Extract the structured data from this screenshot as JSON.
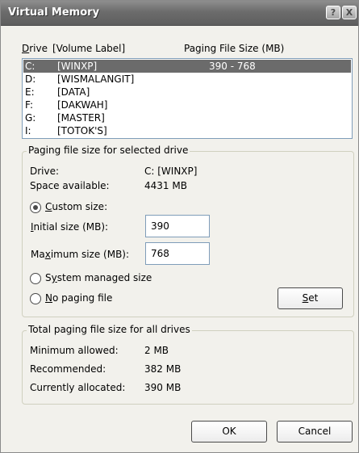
{
  "window": {
    "title": "Virtual Memory",
    "help_glyph": "?",
    "close_glyph": "X"
  },
  "list": {
    "headers": {
      "drive": "Drive",
      "volume_label": "[Volume Label]",
      "paging_size": "Paging File Size (MB)"
    },
    "rows": [
      {
        "drive": "C:",
        "label": "[WINXP]",
        "size": "390 - 768",
        "selected": true
      },
      {
        "drive": "D:",
        "label": "[WISMALANGIT]",
        "size": ""
      },
      {
        "drive": "E:",
        "label": "[DATA]",
        "size": ""
      },
      {
        "drive": "F:",
        "label": "[DAKWAH]",
        "size": ""
      },
      {
        "drive": "G:",
        "label": "[MASTER]",
        "size": ""
      },
      {
        "drive": "I:",
        "label": "[TOTOK'S]",
        "size": ""
      }
    ]
  },
  "selected_drive": {
    "group_title": "Paging file size for selected drive",
    "drive_label": "Drive:",
    "drive_value": "C:  [WINXP]",
    "space_label": "Space available:",
    "space_value": "4431 MB",
    "custom_size": {
      "label_prefix": "",
      "label_mnemonic": "C",
      "label_rest": "ustom size:",
      "checked": true
    },
    "initial": {
      "label_mnemonic": "I",
      "label_rest": "nitial size (MB):",
      "value": "390"
    },
    "maximum": {
      "label_prefix": "Ma",
      "label_mnemonic": "x",
      "label_rest": "imum size (MB):",
      "value": "768"
    },
    "system_managed": {
      "label_prefix": "S",
      "label_mnemonic": "y",
      "label_rest": "stem managed size",
      "checked": false
    },
    "no_paging": {
      "label_mnemonic": "N",
      "label_rest": "o paging file",
      "checked": false
    },
    "set_button": {
      "label_mnemonic": "S",
      "label_rest": "et"
    }
  },
  "totals": {
    "group_title": "Total paging file size for all drives",
    "minimum_label": "Minimum allowed:",
    "minimum_value": "2 MB",
    "recommended_label": "Recommended:",
    "recommended_value": "382 MB",
    "allocated_label": "Currently allocated:",
    "allocated_value": "390 MB"
  },
  "buttons": {
    "ok": "OK",
    "cancel": "Cancel"
  }
}
